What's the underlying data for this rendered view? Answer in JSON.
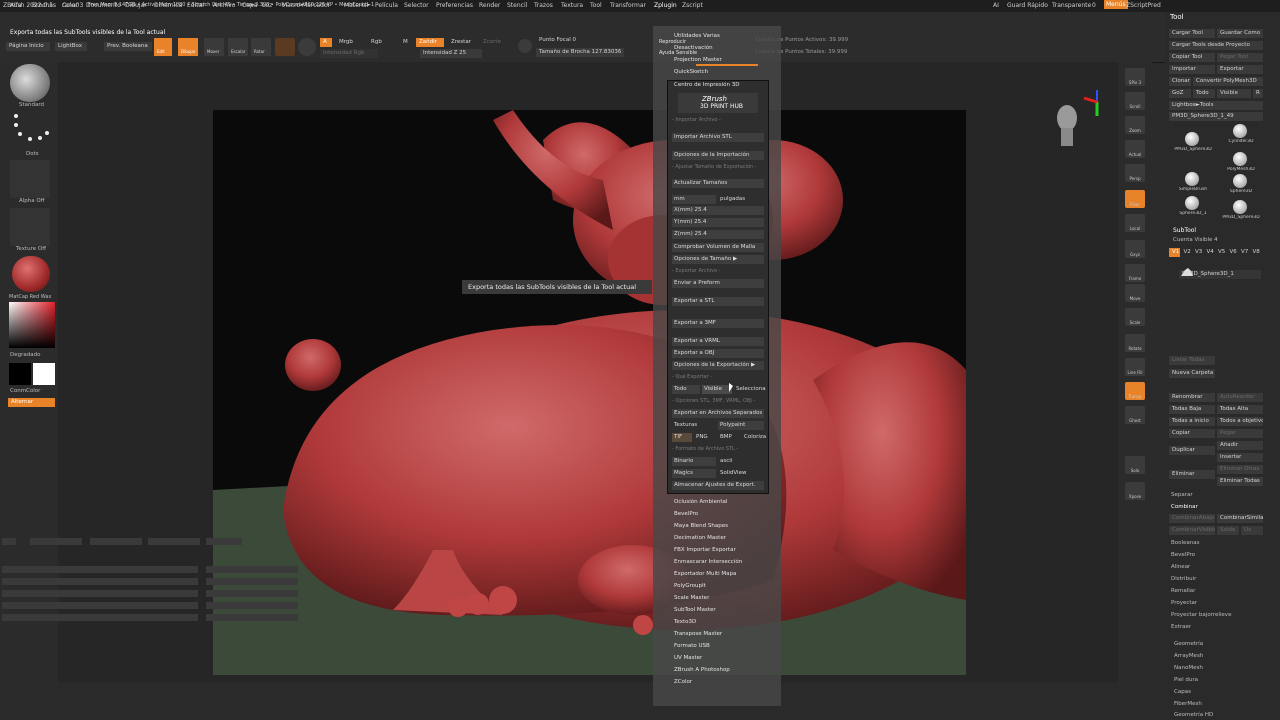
{
  "menubar": {
    "app": "ZBrush 2022.0.5",
    "file": "rana03",
    "mem": "Free Mem 9.147GB • Active Mem 1080 • Scratch Disk 49 • Timer►3.398 • PolyCount►960.276 KP • MeshCount►1",
    "items": [
      "Alfa",
      "Brochas",
      "Color",
      "Documento",
      "Dibujar",
      "Dinámica",
      "Editar",
      "Archivo",
      "Capa",
      "Luz",
      "Macro",
      "Marcador",
      "Material",
      "Película",
      "Selector",
      "Preferencias",
      "Render",
      "Stencil",
      "Trazos",
      "Textura",
      "Tool",
      "Transformar",
      "Zplugin",
      "Zscript"
    ],
    "ai": "AI",
    "quicksave": "Guard Rápido",
    "transparency": "Transparente",
    "transparency_val": "0",
    "menus_btn": "Menús",
    "zscript_preset": "ZScriptPred"
  },
  "status_text": "Exporta todas las SubTools visibles de la Tool actual",
  "topbar": {
    "home": "Página Inicio",
    "lightbox": "LightBox",
    "prev_bool": "Prev. Booleana",
    "edit": "Edit",
    "draw": "Dibujar",
    "move": "Mover",
    "scale": "Escalar",
    "rotate": "Rotar",
    "a": "A",
    "mrgb": "Mrgb",
    "rgb": "Rgb",
    "m": "M",
    "zadd": "Zañdir",
    "zsub": "Zrestar",
    "zcut": "Zcorte",
    "rgb_int": "Intensidad Rgb",
    "z_int": "Intensidad Z 25",
    "focal": "Punto Focal 0",
    "draw_size": "Tamaño de Brocha 127.83036",
    "active_pts": "Cuenta de Puntos Activos: 39.999",
    "total_pts": "Cuenta de Puntos Totales: 39.999"
  },
  "left": {
    "brush": "Standard",
    "stroke": "Dots",
    "alpha": "Alpha Off",
    "texture": "Texture Off",
    "material": "MatCap Red Wax",
    "gradient": "Degradado",
    "switch_color": "ConmColor",
    "alternate": "Alternar"
  },
  "tooltip": "Exporta todas las SubTools visibles de la Tool actual",
  "zplugin_top": [
    "Utilidades Varias",
    "Desactivación",
    "Projection Master",
    "QuickSketch"
  ],
  "zplugin_top_dim": [
    "Reproducir",
    "Ayuda Sensible"
  ],
  "print_hub": {
    "title": "Centro de Impresión 3D",
    "logo1": "ZBrush",
    "logo2": "3D PRINT HUB",
    "h_import": "- Importar Archivo -",
    "import_stl": "Importar Archivo STL",
    "import_opts": "Opciones de la Importación",
    "h_size": "- Ajustar Tamaño de Exportación -",
    "update_size": "Actualizar Tamaños",
    "mm": "mm",
    "inches": "pulgadas",
    "x": "X(mm) 25.4",
    "y": "Y(mm) 25.4",
    "z": "Z(mm) 25.4",
    "check_vol": "Comprobar Volumen de Malla",
    "size_opts": "Opciones de Tamaño ▶",
    "h_export": "- Exportar Archivo -",
    "send_preform": "Enviar a Preform",
    "export_stl": "Exportar a STL",
    "export_3mf": "Exportar a 3MF",
    "export_vrml": "Exportar a VRML",
    "export_obj": "Exportar a OBJ",
    "export_opts": "Opciones de la Exportación ▶",
    "h_what": "- Qué Exportar -",
    "all": "Todo",
    "visible": "Visible",
    "selected": "Seleccionado",
    "h_opts": "- Opciones STL, 3MF, VRML, OBJ -",
    "separate": "Exportar en Archivos Separados",
    "textures": "Texturas",
    "polypaint": "Polypaint",
    "tif": "TIF",
    "png": "PNG",
    "bmp": "BMP",
    "colorize": "Colorizar",
    "h_format": "- Formato de Archivo STL -",
    "binary": "Binario",
    "ascii": "ascii",
    "magics": "Magics",
    "solidview": "SolidView",
    "save_settings": "Almacenar Ajustes de Export."
  },
  "zplugin_bottom": [
    "Oclusión Ambiental",
    "BevelPro",
    "Maya Blend Shapes",
    "Decimation Master",
    "FBX Importar Exportar",
    "Enmascarar Intersección",
    "Exportador Multi Mapa",
    "PolyGroupIt",
    "Scale Master",
    "SubTool Master",
    "Texto3D",
    "Transpose Master",
    "Formato USB",
    "UV Master",
    "ZBrush A Photoshop",
    "ZColor"
  ],
  "right_shelf": [
    "SPix 3",
    "Scroll",
    "Zoom",
    "Actual",
    "Persp",
    "Floor",
    "Local",
    "Gxyz",
    "Frame",
    "Move",
    "Scale",
    "Rotate",
    "Line Fill",
    "Transp",
    "Ghost",
    "Solo",
    "Xpose"
  ],
  "tool_panel": {
    "title": "Tool",
    "load": "Cargar Tool",
    "save_as": "Guardar Como",
    "load_proj": "Cargar Tools desde Proyecto",
    "copy": "Copiar Tool",
    "paste": "Pegar Tool",
    "import": "Importar",
    "export": "Exportar",
    "clone": "Clonar",
    "make_poly": "Convertir PolyMesh3D",
    "goz": "GoZ",
    "all": "Todo",
    "visible": "Visible",
    "r": "R",
    "lightbox_tools": "Lightbox►Tools",
    "current": "PM3D_Sphere3D_1_49",
    "thumbs": [
      "PM3D_Sphere3D",
      "Cylinder3D",
      "SimpleBrush",
      "PolyMesh3D",
      "Sphere3D_1",
      "Sphere3D",
      "PM3D_Sphere3D"
    ],
    "subtool": "SubTool",
    "visible_count": "Cuenta Visible 4",
    "v_tabs": [
      "V1",
      "V2",
      "V3",
      "V4",
      "V5",
      "V6",
      "V7",
      "V8"
    ],
    "subtool_item": "PM3D_Sphere3D_1",
    "list_all": "Listar Todas",
    "new_folder": "Nueva Carpeta",
    "rename": "Renombrar",
    "autoreorder": "AutoReorder",
    "all_low": "Todas Baja",
    "all_high": "Todas Alta",
    "all_top": "Todas a inicio",
    "all_target": "Todos a objetivo",
    "copy2": "Copiar",
    "paste2": "Pegar",
    "duplicate": "Duplicar",
    "append": "Añadir",
    "insert": "Insertar",
    "delete": "Eliminar",
    "del_other": "Eliminar Otras",
    "del_all": "Eliminar Todas",
    "split": "Separar",
    "merge": "Combinar",
    "merge_down": "CombinarAbajo",
    "merge_similar": "CombinarSimilar",
    "merge_visible": "CombinarVisible",
    "weld": "Solda",
    "uv": "Uv",
    "boolean": "Booleanas",
    "bevelpro": "BevelPro",
    "align": "Alinear",
    "distribute": "Distribuir",
    "remesh": "Remallar",
    "project": "Proyectar",
    "project_bas": "Proyectar bajorrelieve",
    "extract": "Extraer",
    "geometry": "Geometría",
    "arraymesh": "ArrayMesh",
    "nanomesh": "NanoMesh",
    "thick_skin": "Piel dura",
    "layers": "Capas",
    "fibermesh": "FiberMesh",
    "geometry_hd": "Geometría HD"
  },
  "colors": {
    "accent": "#e8832a",
    "clay": "#b0393a",
    "bg": "#2a2a2a"
  }
}
